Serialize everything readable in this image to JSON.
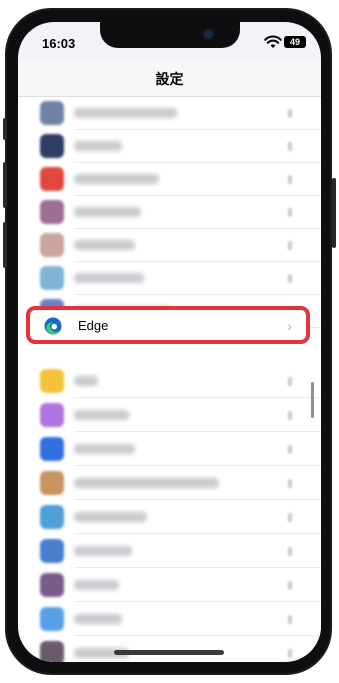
{
  "status_bar": {
    "time": "16:03",
    "battery": "49"
  },
  "nav": {
    "title": "設定"
  },
  "highlighted_app": {
    "label": "Edge",
    "chevron": "›"
  },
  "blurred_rows": [
    {
      "icon_color": "#6f83a8",
      "text_width": "34%"
    },
    {
      "icon_color": "#2f3d63",
      "text_width": "16%"
    },
    {
      "icon_color": "#e0483e",
      "text_width": "28%"
    },
    {
      "icon_color": "#9e6e96",
      "text_width": "22%"
    },
    {
      "icon_color": "#c9a59d",
      "text_width": "20%"
    },
    {
      "icon_color": "#7fb4d6",
      "text_width": "23%"
    },
    {
      "icon_color": "#6a80c8",
      "text_width": "32%"
    },
    {
      "icon_color": "#f3c23a",
      "text_width": "8%"
    },
    {
      "icon_color": "#b074e0",
      "text_width": "18%"
    },
    {
      "icon_color": "#2f6fe0",
      "text_width": "20%"
    },
    {
      "icon_color": "#c89460",
      "text_width": "48%"
    },
    {
      "icon_color": "#4f9fd8",
      "text_width": "24%"
    },
    {
      "icon_color": "#4a7fd0",
      "text_width": "19%"
    },
    {
      "icon_color": "#7a5c8a",
      "text_width": "15%"
    },
    {
      "icon_color": "#5aa0e8",
      "text_width": "16%"
    },
    {
      "icon_color": "#6a5a6a",
      "text_width": "18%"
    },
    {
      "icon_color": "#e8c43a",
      "text_width": "12%"
    }
  ],
  "colors": {
    "highlight_border": "#e0353b",
    "edge_blue": "#1467c7",
    "edge_green": "#3ccc6c"
  }
}
